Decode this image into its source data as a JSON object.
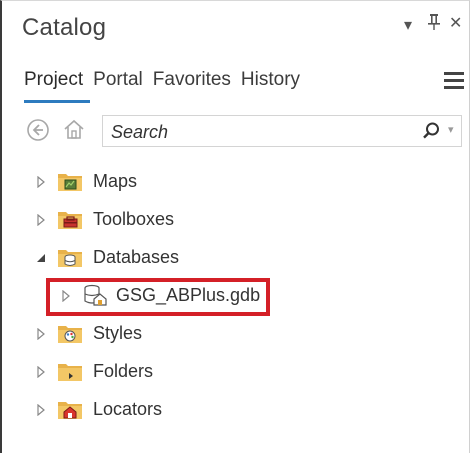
{
  "pane": {
    "title": "Catalog",
    "controls": {
      "dropdown": "▾",
      "pin": "ᛘ",
      "close": "✕"
    }
  },
  "tabs": [
    {
      "label": "Project",
      "active": true
    },
    {
      "label": "Portal",
      "active": false
    },
    {
      "label": "Favorites",
      "active": false
    },
    {
      "label": "History",
      "active": false
    }
  ],
  "toolbar": {
    "search_placeholder": "Search",
    "icons": [
      "back-icon",
      "home-icon",
      "search-icon",
      "chevron-down-icon"
    ]
  },
  "tree": {
    "items": [
      {
        "label": "Maps",
        "icon": "maps-folder-icon",
        "expanded": false,
        "level": 0
      },
      {
        "label": "Toolboxes",
        "icon": "toolboxes-folder-icon",
        "expanded": false,
        "level": 0
      },
      {
        "label": "Databases",
        "icon": "databases-folder-icon",
        "expanded": true,
        "level": 0
      },
      {
        "label": "GSG_ABPlus.gdb",
        "icon": "geodatabase-icon",
        "expanded": false,
        "level": 1,
        "highlighted": true
      },
      {
        "label": "Styles",
        "icon": "styles-folder-icon",
        "expanded": false,
        "level": 0
      },
      {
        "label": "Folders",
        "icon": "folders-folder-icon",
        "expanded": false,
        "level": 0
      },
      {
        "label": "Locators",
        "icon": "locators-folder-icon",
        "expanded": false,
        "level": 0
      }
    ]
  },
  "colors": {
    "accent": "#2d7bbf",
    "highlight": "#d42027",
    "folder": "#e8b24a"
  }
}
